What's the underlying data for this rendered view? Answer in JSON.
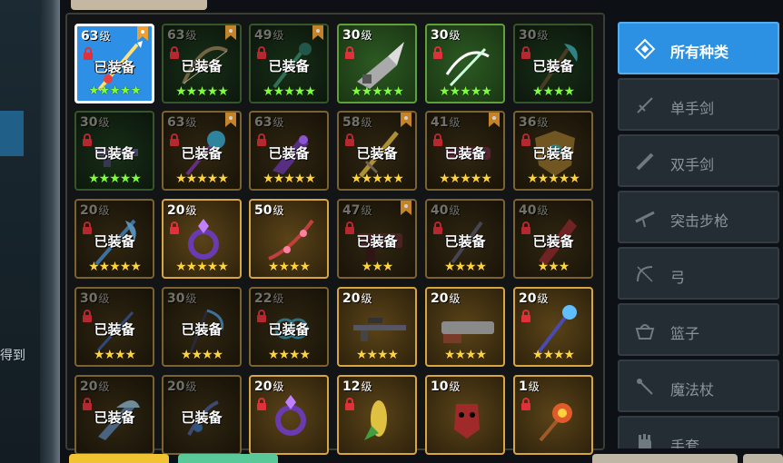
{
  "side_text": "得到",
  "equipped_label": "已装备",
  "level_suffix": "级",
  "colors": {
    "selected": "#2d8fe6",
    "legendary": "#d7a640",
    "rare": "#5ea03a",
    "category_active": "#2c91e2"
  },
  "items": [
    {
      "level": "63",
      "equipped": true,
      "locked": true,
      "bookmark": true,
      "stars": 5,
      "star_color": "green",
      "frame": "selected",
      "icon": "spear-icon"
    },
    {
      "level": "63",
      "equipped": true,
      "locked": true,
      "bookmark": true,
      "stars": 5,
      "star_color": "green",
      "frame": "green",
      "icon": "bow-icon"
    },
    {
      "level": "49",
      "equipped": true,
      "locked": true,
      "bookmark": true,
      "stars": 5,
      "star_color": "green",
      "frame": "green",
      "icon": "staff-icon"
    },
    {
      "level": "30",
      "equipped": false,
      "locked": true,
      "bookmark": false,
      "stars": 5,
      "star_color": "green",
      "frame": "lgreen",
      "icon": "drill-gun-icon"
    },
    {
      "level": "30",
      "equipped": false,
      "locked": true,
      "bookmark": false,
      "stars": 5,
      "star_color": "green",
      "frame": "lgreen",
      "icon": "crossbow-icon"
    },
    {
      "level": "30",
      "equipped": true,
      "locked": true,
      "bookmark": false,
      "stars": 4,
      "star_color": "green",
      "frame": "green",
      "icon": "axe-icon"
    },
    {
      "level": "30",
      "equipped": true,
      "locked": true,
      "bookmark": false,
      "stars": 5,
      "star_color": "green",
      "frame": "green",
      "icon": "rifle-icon"
    },
    {
      "level": "63",
      "equipped": true,
      "locked": true,
      "bookmark": true,
      "stars": 5,
      "star_color": "yellow",
      "frame": "gold",
      "icon": "orb-staff-icon"
    },
    {
      "level": "63",
      "equipped": true,
      "locked": true,
      "bookmark": false,
      "stars": 5,
      "star_color": "yellow",
      "frame": "gold",
      "icon": "blade-icon"
    },
    {
      "level": "58",
      "equipped": true,
      "locked": true,
      "bookmark": true,
      "stars": 5,
      "star_color": "yellow",
      "frame": "gold",
      "icon": "sword-icon"
    },
    {
      "level": "41",
      "equipped": true,
      "locked": true,
      "bookmark": true,
      "stars": 5,
      "star_color": "yellow",
      "frame": "gold",
      "icon": "cannon-icon"
    },
    {
      "level": "36",
      "equipped": true,
      "locked": true,
      "bookmark": false,
      "stars": 5,
      "star_color": "yellow",
      "frame": "gold",
      "icon": "shield-icon"
    },
    {
      "level": "20",
      "equipped": true,
      "locked": true,
      "bookmark": false,
      "stars": 5,
      "star_color": "yellow",
      "frame": "gold",
      "icon": "feather-staff-icon"
    },
    {
      "level": "20",
      "equipped": false,
      "locked": true,
      "bookmark": false,
      "stars": 5,
      "star_color": "yellow",
      "frame": "lgold",
      "icon": "ring-icon"
    },
    {
      "level": "50",
      "equipped": false,
      "locked": false,
      "bookmark": false,
      "stars": 4,
      "star_color": "yellow",
      "frame": "lgold",
      "icon": "flower-bow-icon"
    },
    {
      "level": "47",
      "equipped": true,
      "locked": true,
      "bookmark": true,
      "stars": 3,
      "star_color": "yellow",
      "frame": "gold",
      "icon": "blaster-icon"
    },
    {
      "level": "40",
      "equipped": true,
      "locked": true,
      "bookmark": false,
      "stars": 4,
      "star_color": "yellow",
      "frame": "gold",
      "icon": "dagger-icon"
    },
    {
      "level": "40",
      "equipped": true,
      "locked": true,
      "bookmark": false,
      "stars": 3,
      "star_color": "yellow",
      "frame": "gold",
      "icon": "greatsword-icon"
    },
    {
      "level": "30",
      "equipped": true,
      "locked": true,
      "bookmark": false,
      "stars": 4,
      "star_color": "yellow",
      "frame": "gold",
      "icon": "wand-icon"
    },
    {
      "level": "30",
      "equipped": true,
      "locked": false,
      "bookmark": false,
      "stars": 4,
      "star_color": "yellow",
      "frame": "gold",
      "icon": "scythe-icon"
    },
    {
      "level": "22",
      "equipped": true,
      "locked": true,
      "bookmark": false,
      "stars": 4,
      "star_color": "yellow",
      "frame": "gold",
      "icon": "chain-icon"
    },
    {
      "level": "20",
      "equipped": false,
      "locked": false,
      "bookmark": false,
      "stars": 4,
      "star_color": "yellow",
      "frame": "lgold",
      "icon": "sniper-icon"
    },
    {
      "level": "20",
      "equipped": false,
      "locked": false,
      "bookmark": false,
      "stars": 4,
      "star_color": "yellow",
      "frame": "lgold",
      "icon": "shotgun-icon"
    },
    {
      "level": "20",
      "equipped": false,
      "locked": true,
      "bookmark": false,
      "stars": 4,
      "star_color": "yellow",
      "frame": "lgold",
      "icon": "crystal-staff-icon"
    },
    {
      "level": "20",
      "equipped": true,
      "locked": true,
      "bookmark": false,
      "stars": 0,
      "star_color": "yellow",
      "frame": "gold",
      "icon": "wing-blade-icon"
    },
    {
      "level": "20",
      "equipped": true,
      "locked": false,
      "bookmark": false,
      "stars": 0,
      "star_color": "yellow",
      "frame": "gold",
      "icon": "claw-icon"
    },
    {
      "level": "20",
      "equipped": false,
      "locked": true,
      "bookmark": false,
      "stars": 0,
      "star_color": "yellow",
      "frame": "lgold",
      "icon": "ring-icon"
    },
    {
      "level": "12",
      "equipped": false,
      "locked": true,
      "bookmark": false,
      "stars": 0,
      "star_color": "yellow",
      "frame": "lgold",
      "icon": "corn-icon"
    },
    {
      "level": "10",
      "equipped": false,
      "locked": false,
      "bookmark": false,
      "stars": 0,
      "star_color": "yellow",
      "frame": "lgold",
      "icon": "mask-icon"
    },
    {
      "level": "1",
      "equipped": false,
      "locked": true,
      "bookmark": false,
      "stars": 0,
      "star_color": "yellow",
      "frame": "lgold",
      "icon": "rose-wand-icon"
    }
  ],
  "categories": [
    {
      "label": "所有种类",
      "icon": "all-categories-icon",
      "active": true
    },
    {
      "label": "单手剑",
      "icon": "one-hand-sword-icon",
      "active": false
    },
    {
      "label": "双手剑",
      "icon": "two-hand-sword-icon",
      "active": false
    },
    {
      "label": "突击步枪",
      "icon": "assault-rifle-icon",
      "active": false
    },
    {
      "label": "弓",
      "icon": "bow-icon",
      "active": false
    },
    {
      "label": "篮子",
      "icon": "basket-icon",
      "active": false
    },
    {
      "label": "魔法杖",
      "icon": "magic-wand-icon",
      "active": false
    },
    {
      "label": "手套",
      "icon": "glove-icon",
      "active": false
    }
  ]
}
